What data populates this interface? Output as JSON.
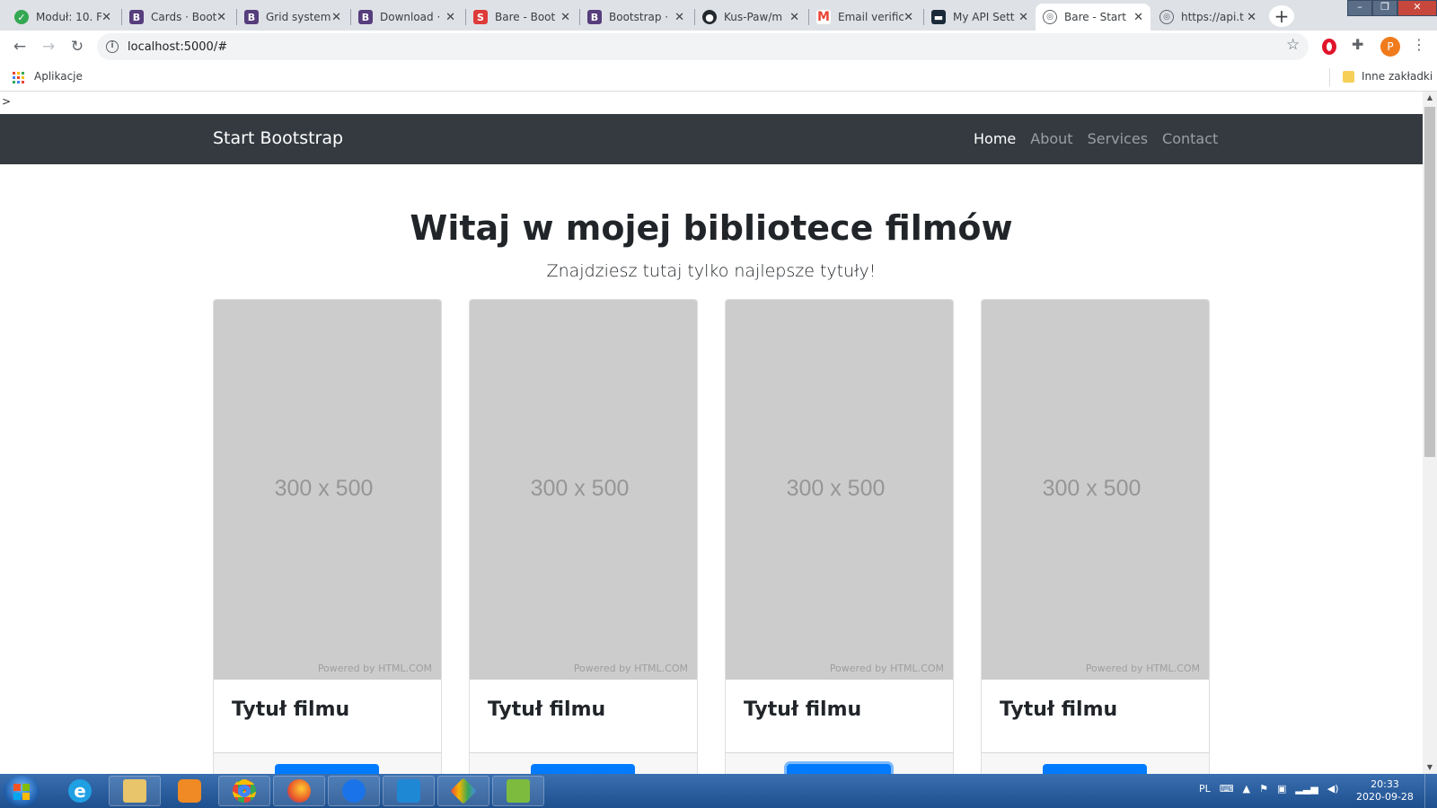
{
  "browser": {
    "tabs": [
      {
        "title": "Moduł: 10. F",
        "icon": "check-circle-icon",
        "color": "#34a853"
      },
      {
        "title": "Cards · Boot",
        "icon": "bootstrap-icon",
        "color": "#563d7c"
      },
      {
        "title": "Grid system",
        "icon": "bootstrap-icon",
        "color": "#563d7c"
      },
      {
        "title": "Download ·",
        "icon": "bootstrap-icon",
        "color": "#563d7c"
      },
      {
        "title": "Bare - Boot",
        "icon": "startbootstrap-icon",
        "color": "#dd3a3a"
      },
      {
        "title": "Bootstrap ·",
        "icon": "bootstrap-icon",
        "color": "#563d7c"
      },
      {
        "title": "Kus-Paw/m",
        "icon": "github-icon",
        "color": "#24292e"
      },
      {
        "title": "Email verific",
        "icon": "gmail-icon",
        "color": "#ea4335"
      },
      {
        "title": "My API Sett",
        "icon": "api-icon",
        "color": "#1b2a38"
      },
      {
        "title": "Bare - Start",
        "icon": "globe-icon",
        "color": "#5f6368"
      },
      {
        "title": "https://api.t",
        "icon": "globe-icon",
        "color": "#5f6368"
      }
    ],
    "active_tab": 9,
    "url": "localhost:5000/#",
    "profile_initial": "P",
    "bookmarks": {
      "apps_label": "Aplikacje",
      "other_label": "Inne zakładki"
    }
  },
  "page": {
    "stray_text": ">",
    "navbar": {
      "brand": "Start Bootstrap",
      "links": [
        {
          "label": "Home",
          "active": true
        },
        {
          "label": "About",
          "active": false
        },
        {
          "label": "Services",
          "active": false
        },
        {
          "label": "Contact",
          "active": false
        }
      ]
    },
    "hero": {
      "title": "Witaj w mojej bibliotece filmów",
      "subtitle": "Znajdziesz tutaj tylko najlepsze tytuły!"
    },
    "cards": [
      {
        "placeholder": "300 x 500",
        "powered": "Powered by HTML.COM",
        "title": "Tytuł filmu"
      },
      {
        "placeholder": "300 x 500",
        "powered": "Powered by HTML.COM",
        "title": "Tytuł filmu"
      },
      {
        "placeholder": "300 x 500",
        "powered": "Powered by HTML.COM",
        "title": "Tytuł filmu"
      },
      {
        "placeholder": "300 x 500",
        "powered": "Powered by HTML.COM",
        "title": "Tytuł filmu"
      }
    ],
    "colors": {
      "navbar": "#343a40",
      "primary": "#007bff",
      "placeholder": "#cccccc"
    }
  },
  "taskbar": {
    "language": "PL",
    "time": "20:33",
    "date": "2020-09-28"
  }
}
